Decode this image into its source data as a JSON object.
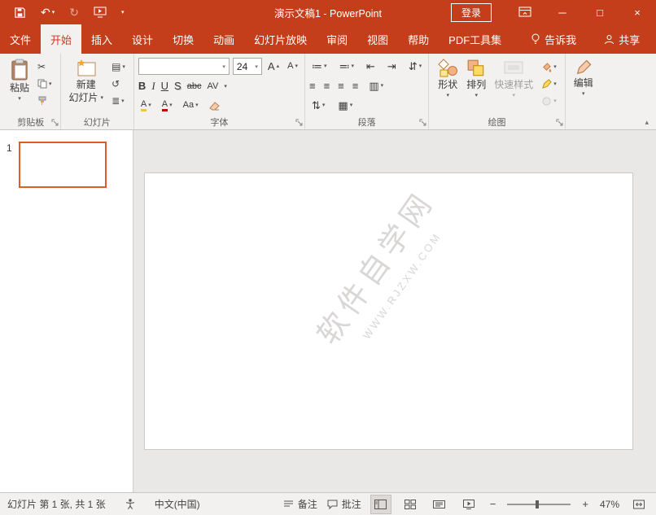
{
  "titlebar": {
    "title": "演示文稿1  -  PowerPoint",
    "sign_in": "登录"
  },
  "tabs": {
    "file": "文件",
    "home": "开始",
    "insert": "插入",
    "design": "设计",
    "transitions": "切换",
    "animations": "动画",
    "slide_show": "幻灯片放映",
    "review": "审阅",
    "view": "视图",
    "help": "帮助",
    "pdf_tools": "PDF工具集",
    "tell_me": "告诉我",
    "share": "共享"
  },
  "clipboard": {
    "paste": "粘贴",
    "group": "剪贴板"
  },
  "slides": {
    "new_slide_line1": "新建",
    "new_slide_line2": "幻灯片",
    "group": "幻灯片"
  },
  "font": {
    "size": "24",
    "group": "字体",
    "bold": "B",
    "italic": "I",
    "underline": "U",
    "shadow": "S",
    "strike": "abc",
    "spacing": "AV",
    "case": "Aa",
    "color": "A",
    "highlight": "A",
    "grow": "A",
    "shrink": "A"
  },
  "paragraph": {
    "group": "段落"
  },
  "drawing": {
    "shapes": "形状",
    "arrange": "排列",
    "quick_styles": "快速样式",
    "group": "绘图"
  },
  "editing": {
    "edit": "编辑"
  },
  "thumbnails": {
    "slide_number": "1"
  },
  "slide": {
    "watermark_title": "软件自学网",
    "watermark_url": "WWW.RJZXW.COM"
  },
  "statusbar": {
    "slide_info": "幻灯片 第 1 张, 共 1 张",
    "language": "中文(中国)",
    "notes": "备注",
    "comments": "批注",
    "zoom": "47%"
  },
  "icons": {
    "dropdown": "▾",
    "undo": "↶",
    "redo": "↻",
    "collapse": "▴",
    "cut": "✂",
    "minimize": "─",
    "maximize": "□",
    "close": "×",
    "layout": "▤",
    "reset": "↺",
    "section": "≣",
    "bullets": "≔",
    "numbering": "≕",
    "indent_dec": "⇤",
    "indent_inc": "⇥",
    "line_spacing": "⇅",
    "text_direction": "⇵",
    "align_left": "≡",
    "align_center": "≡",
    "align_right": "≡",
    "justify": "≡",
    "columns": "▥",
    "smartart": "▦",
    "zoom_out": "−",
    "zoom_in": "+"
  }
}
